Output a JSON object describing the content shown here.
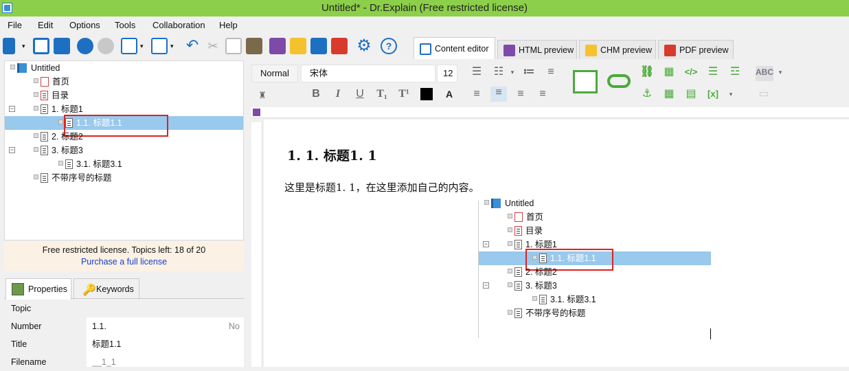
{
  "window": {
    "title": "Untitled* - Dr.Explain (Free restricted license)"
  },
  "menu": [
    "File",
    "Edit",
    "Options",
    "Tools",
    "Collaboration",
    "Help"
  ],
  "tabs": [
    {
      "label": "Content editor",
      "icon": "edit-icon",
      "active": true
    },
    {
      "label": "HTML preview",
      "icon": "html-icon",
      "active": false
    },
    {
      "label": "CHM preview",
      "icon": "chm-icon",
      "active": false
    },
    {
      "label": "PDF preview",
      "icon": "pdf-icon",
      "active": false
    }
  ],
  "tree": {
    "root": "Untitled",
    "items": [
      {
        "label": "首页",
        "icon": "home-page-icon"
      },
      {
        "label": "目录",
        "icon": "toc-icon"
      },
      {
        "label": "1. 标题1",
        "icon": "doc-icon",
        "expanded": true
      },
      {
        "label": "1.1. 标题1.1",
        "icon": "doc-icon",
        "selected": true
      },
      {
        "label": "2. 标题2",
        "icon": "doc-icon"
      },
      {
        "label": "3. 标题3",
        "icon": "doc-icon",
        "expanded": true
      },
      {
        "label": "3.1. 标题3.1",
        "icon": "doc-icon"
      },
      {
        "label": "不带序号的标题",
        "icon": "doc-icon"
      }
    ]
  },
  "license": {
    "message": "Free restricted license. Topics left: 18 of 20",
    "link": "Purchase a full license"
  },
  "property_tabs": [
    {
      "label": "Properties",
      "icon": "properties-icon"
    },
    {
      "label": "Keywords",
      "icon": "key-icon"
    }
  ],
  "properties": {
    "section": "Topic",
    "rows": [
      {
        "key": "Number",
        "value": "1.1.",
        "extra": "No"
      },
      {
        "key": "Title",
        "value": "标题1.1"
      },
      {
        "key": "Filename",
        "value": "__1_1"
      }
    ]
  },
  "format": {
    "style": "Normal",
    "font": "宋体",
    "size": "12"
  },
  "editor": {
    "heading": "1. 1.   标题1. 1",
    "paragraph": "这里是标题1. 1，在这里添加自己的内容。"
  },
  "colors": {
    "titlebar": "#8ccf4a",
    "selection": "#99c9ec",
    "highlight_box": "#e02020",
    "link": "#1a40c8",
    "license_bg": "#fbf1e4"
  }
}
